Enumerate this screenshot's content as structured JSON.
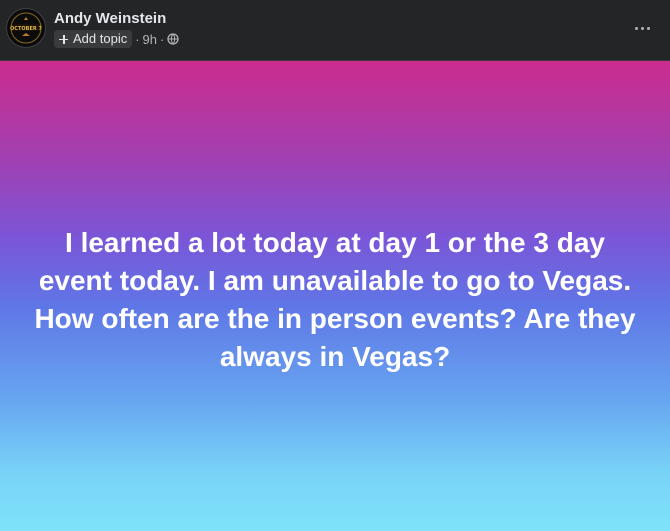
{
  "post": {
    "author": "Andy Weinstein",
    "avatar_text": "OCTOBER 7",
    "add_topic_label": "Add topic",
    "separator": "·",
    "timestamp": "9h",
    "privacy_icon": "globe-icon",
    "more_icon": "more-horizontal-icon",
    "text": "I learned a lot today at day 1 or the 3 day event today. I am unavailable to go to Vegas. How often are the in person events? Are they always in Vegas?",
    "background_gradient": [
      "#cb2c8e",
      "#7a56d8",
      "#7fe2fa"
    ]
  }
}
